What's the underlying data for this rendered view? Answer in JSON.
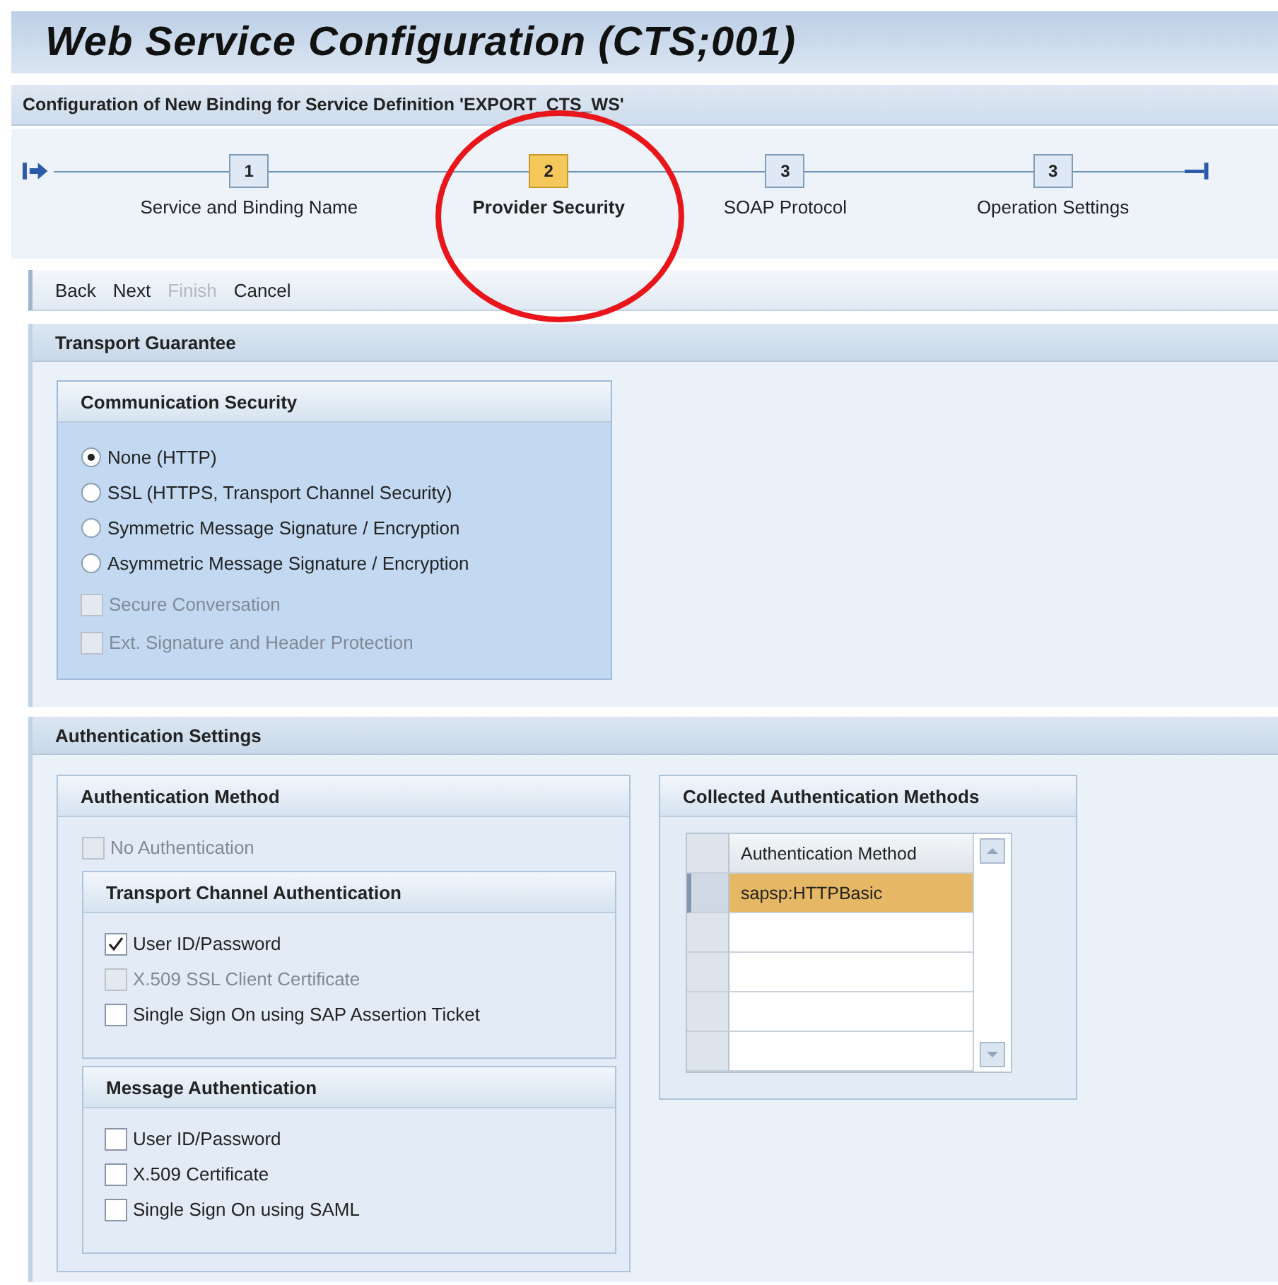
{
  "window": {
    "title": "Web Service Configuration (CTS;001)",
    "subtitle": "Configuration of New Binding for Service Definition 'EXPORT_CTS_WS'"
  },
  "roadmap": {
    "steps": [
      {
        "number": "1",
        "label": "Service and Binding Name",
        "selected": false
      },
      {
        "number": "2",
        "label": "Provider Security",
        "selected": true
      },
      {
        "number": "3",
        "label": "SOAP Protocol",
        "selected": false
      },
      {
        "number": "3",
        "label": "Operation Settings",
        "selected": false
      }
    ]
  },
  "toolbar": {
    "buttons": [
      {
        "label": "Back",
        "disabled": false
      },
      {
        "label": "Next",
        "disabled": false
      },
      {
        "label": "Finish",
        "disabled": true
      },
      {
        "label": "Cancel",
        "disabled": false
      }
    ]
  },
  "transport_guarantee": {
    "title": "Transport Guarantee",
    "communication_security": {
      "title": "Communication Security",
      "radios": [
        {
          "label": "None (HTTP)",
          "selected": true
        },
        {
          "label": "SSL (HTTPS, Transport Channel Security)",
          "selected": false
        },
        {
          "label": "Symmetric Message Signature / Encryption",
          "selected": false
        },
        {
          "label": "Asymmetric Message Signature / Encryption",
          "selected": false
        }
      ],
      "checkboxes": [
        {
          "label": "Secure Conversation",
          "checked": false,
          "disabled": true
        },
        {
          "label": "Ext. Signature and Header Protection",
          "checked": false,
          "disabled": true
        }
      ]
    }
  },
  "authentication_settings": {
    "title": "Authentication Settings",
    "authentication_method": {
      "title": "Authentication Method",
      "no_authentication": {
        "label": "No Authentication",
        "checked": false,
        "disabled": true
      },
      "transport_channel": {
        "title": "Transport Channel Authentication",
        "options": [
          {
            "label": "User ID/Password",
            "checked": true,
            "disabled": false
          },
          {
            "label": "X.509 SSL Client Certificate",
            "checked": false,
            "disabled": true
          },
          {
            "label": "Single Sign On using SAP Assertion Ticket",
            "checked": false,
            "disabled": false
          }
        ]
      },
      "message": {
        "title": "Message Authentication",
        "options": [
          {
            "label": "User ID/Password",
            "checked": false,
            "disabled": false
          },
          {
            "label": "X.509 Certificate",
            "checked": false,
            "disabled": false
          },
          {
            "label": "Single Sign On using SAML",
            "checked": false,
            "disabled": false
          }
        ]
      }
    },
    "collected": {
      "title": "Collected Authentication Methods",
      "table": {
        "columns": [
          "Authentication Method"
        ],
        "rows": [
          {
            "cells": [
              "sapsp:HTTPBasic"
            ],
            "selected": true
          }
        ]
      }
    }
  }
}
